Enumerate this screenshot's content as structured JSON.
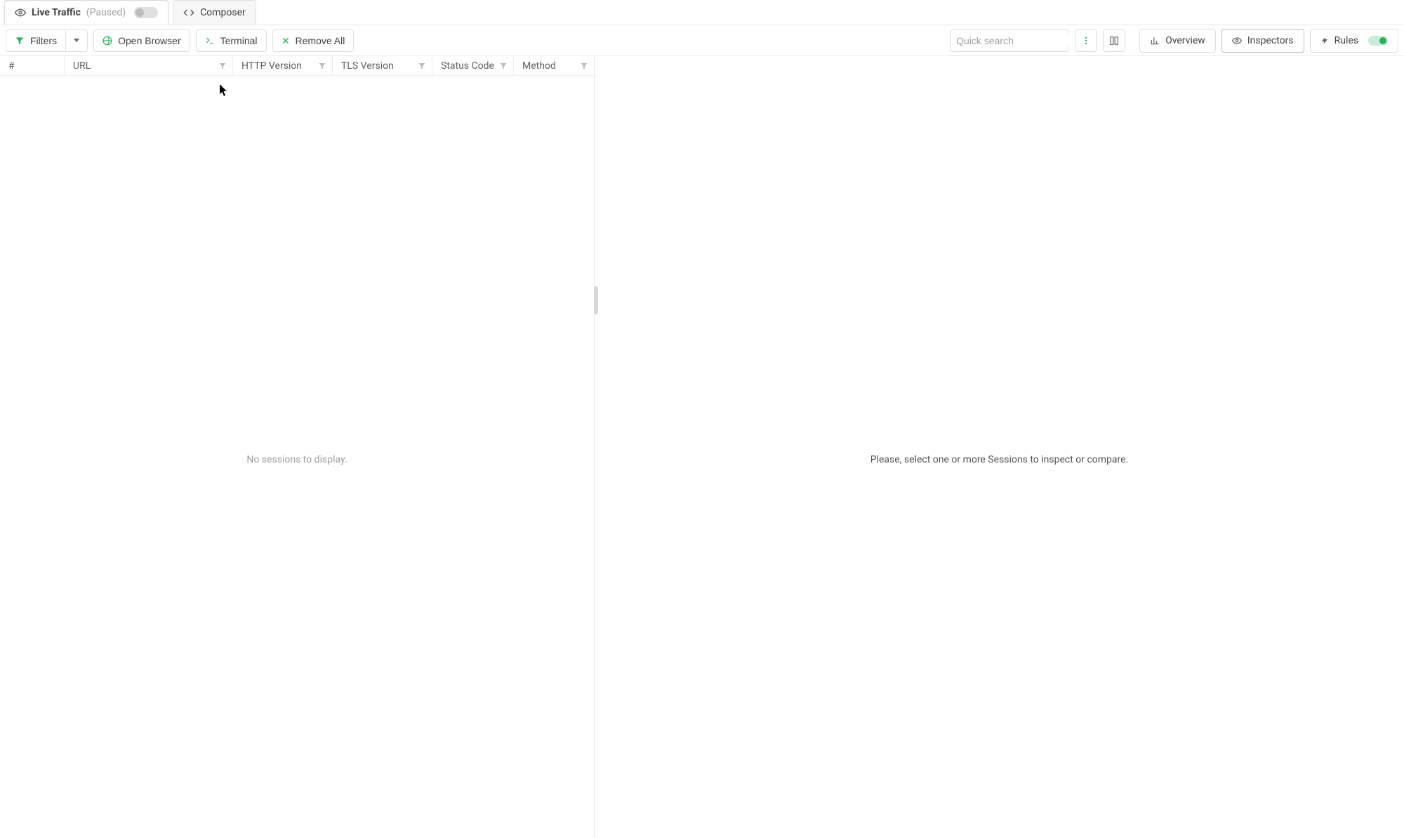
{
  "tabs": {
    "live_traffic": {
      "label": "Live Traffic",
      "status": "(Paused)"
    },
    "composer": {
      "label": "Composer"
    }
  },
  "toolbar": {
    "filters": "Filters",
    "open_browser": "Open Browser",
    "terminal": "Terminal",
    "remove_all": "Remove All",
    "search_placeholder": "Quick search"
  },
  "right_tabs": {
    "overview": "Overview",
    "inspectors": "Inspectors",
    "rules": "Rules"
  },
  "columns": {
    "num": "#",
    "url": "URL",
    "http_ver": "HTTP Version",
    "tls_ver": "TLS Version",
    "status": "Status Code",
    "method": "Method"
  },
  "messages": {
    "no_sessions": "No sessions to display.",
    "select_session": "Please, select one or more Sessions to inspect or compare."
  },
  "colors": {
    "accent_green": "#27b35d"
  }
}
